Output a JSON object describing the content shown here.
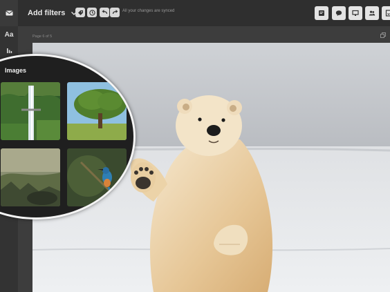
{
  "toolbar": {
    "add_filters_label": "Add filters",
    "sync_status": "All your changes are synced"
  },
  "sidebar": {
    "items": [
      {
        "label": "Aa",
        "icon": "text-icon"
      },
      {
        "label": "",
        "icon": "chart-icon"
      },
      {
        "label": "",
        "icon": "settings-icon"
      }
    ]
  },
  "canvas": {
    "page_label": "Page 6 of 5"
  },
  "images_panel": {
    "title": "Images",
    "thumbnails": [
      {
        "subject": "waterfall"
      },
      {
        "subject": "tree"
      },
      {
        "subject": "mountain-valley"
      },
      {
        "subject": "kingfisher"
      }
    ]
  },
  "main_photo": {
    "subject": "polar-bear"
  }
}
